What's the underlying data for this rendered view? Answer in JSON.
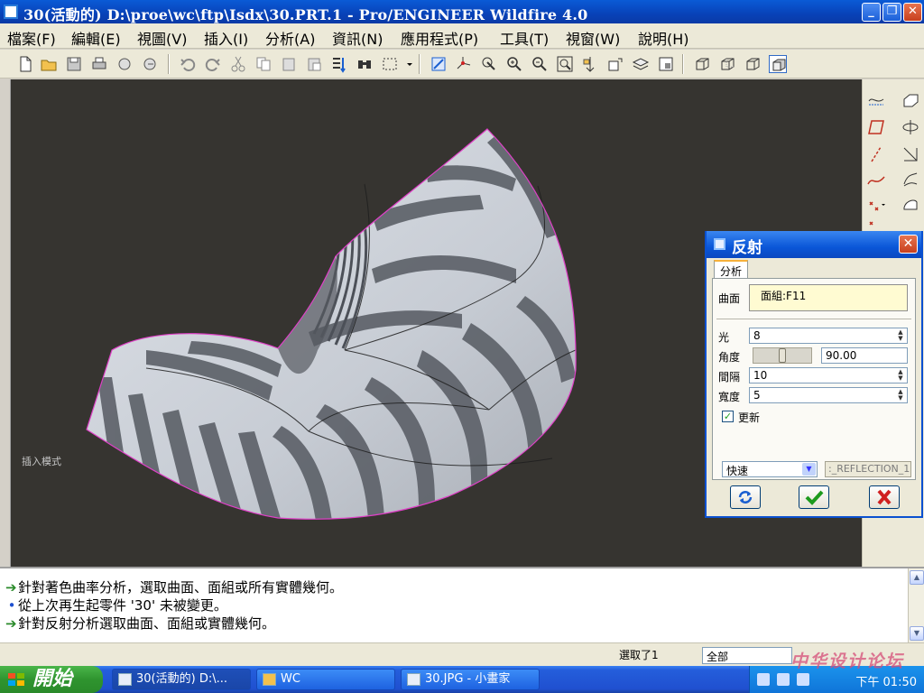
{
  "window": {
    "title": "30(活動的) D:\\proe\\wc\\ftp\\Isdx\\30.PRT.1 - Pro/ENGINEER Wildfire 4.0",
    "minimize": "_",
    "maximize": "❐",
    "close": "✕"
  },
  "menu": [
    "檔案(F)",
    "編輯(E)",
    "視圖(V)",
    "插入(I)",
    "分析(A)",
    "資訊(N)",
    "應用程式(P)",
    "工具(T)",
    "視窗(W)",
    "說明(H)"
  ],
  "viewport": {
    "mode_label": "插入模式"
  },
  "dialog": {
    "title": "反射",
    "close": "✕",
    "tab": "分析",
    "surface_label": "曲面",
    "surface_value": "面組:F11",
    "light_label": "光",
    "light_value": "8",
    "angle_label": "角度",
    "angle_value": "90.00",
    "spacing_label": "間隔",
    "spacing_value": "10",
    "width_label": "寬度",
    "width_value": "5",
    "update_label": "更新",
    "update_checked": true,
    "speed_value": "快速",
    "name_value": ":_REFLECTION_1"
  },
  "messages": [
    {
      "icon": "arrow",
      "text": "針對著色曲率分析，選取曲面、面組或所有實體幾何。"
    },
    {
      "icon": "dot",
      "text": "從上次再生起零件 '30' 未被變更。"
    },
    {
      "icon": "arrow",
      "text": "針對反射分析選取曲面、面組或實體幾何。"
    }
  ],
  "status": {
    "selected": "選取了1",
    "filter": "全部"
  },
  "taskbar": {
    "start": "開始",
    "tasks": [
      "30(活動的) D:\\...",
      "WC",
      "30.JPG - 小畫家"
    ],
    "clock": "下午 01:50"
  },
  "watermark": "中华设计论坛"
}
